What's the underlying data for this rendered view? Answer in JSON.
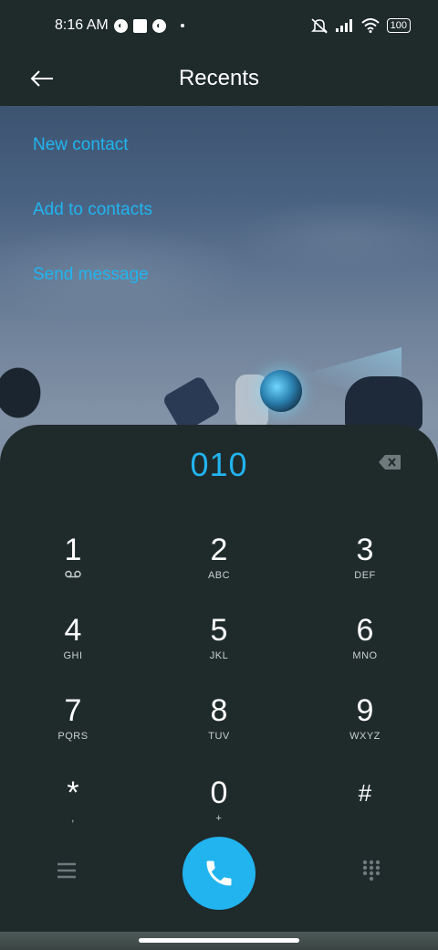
{
  "status_bar": {
    "time": "8:16 AM",
    "battery": "100",
    "icons": [
      "notification-icon",
      "notification-square-icon",
      "notification-icon",
      "dot-icon",
      "silent-icon",
      "signal-icon",
      "wifi-icon",
      "battery-icon"
    ]
  },
  "header": {
    "title": "Recents",
    "back_icon": "arrow-left-icon"
  },
  "actions": {
    "new_contact": "New contact",
    "add_to_contacts": "Add to contacts",
    "send_message": "Send message"
  },
  "dialer": {
    "number": "010",
    "backspace_icon": "backspace-icon",
    "keys": [
      {
        "digit": "1",
        "sub": "voicemail-icon"
      },
      {
        "digit": "2",
        "sub": "ABC"
      },
      {
        "digit": "3",
        "sub": "DEF"
      },
      {
        "digit": "4",
        "sub": "GHI"
      },
      {
        "digit": "5",
        "sub": "JKL"
      },
      {
        "digit": "6",
        "sub": "MNO"
      },
      {
        "digit": "7",
        "sub": "PQRS"
      },
      {
        "digit": "8",
        "sub": "TUV"
      },
      {
        "digit": "9",
        "sub": "WXYZ"
      },
      {
        "digit": "*",
        "sub": ","
      },
      {
        "digit": "0",
        "sub": "+"
      },
      {
        "digit": "#",
        "sub": ""
      }
    ]
  },
  "bottom_bar": {
    "menu_icon": "menu-icon",
    "call_icon": "phone-icon",
    "dialpad_icon": "dialpad-icon"
  },
  "colors": {
    "accent": "#21b4ef",
    "background": "#1f2a2b"
  }
}
